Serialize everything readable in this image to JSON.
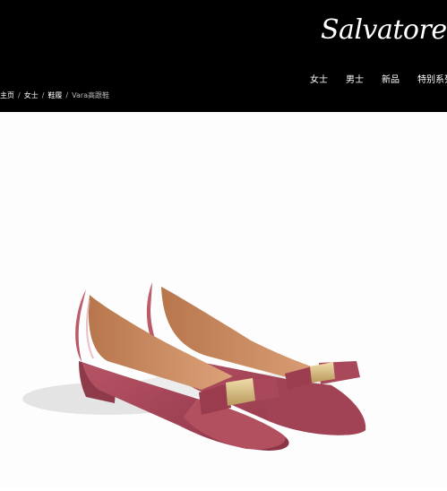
{
  "brand": {
    "logo_text": "Salvatore Ferragamo"
  },
  "nav": {
    "items": [
      "女士",
      "男士",
      "新品",
      "特别系列"
    ]
  },
  "breadcrumb": {
    "items": [
      "主页",
      "女士",
      "鞋履"
    ],
    "separator": "/",
    "current": "Vara高跟鞋"
  },
  "product": {
    "image": "red patent leather Vara pumps with bow and gold plaque",
    "colors": {
      "leather": "#a8485a",
      "lining": "#c9895e",
      "hardware": "#d8c08a"
    }
  }
}
